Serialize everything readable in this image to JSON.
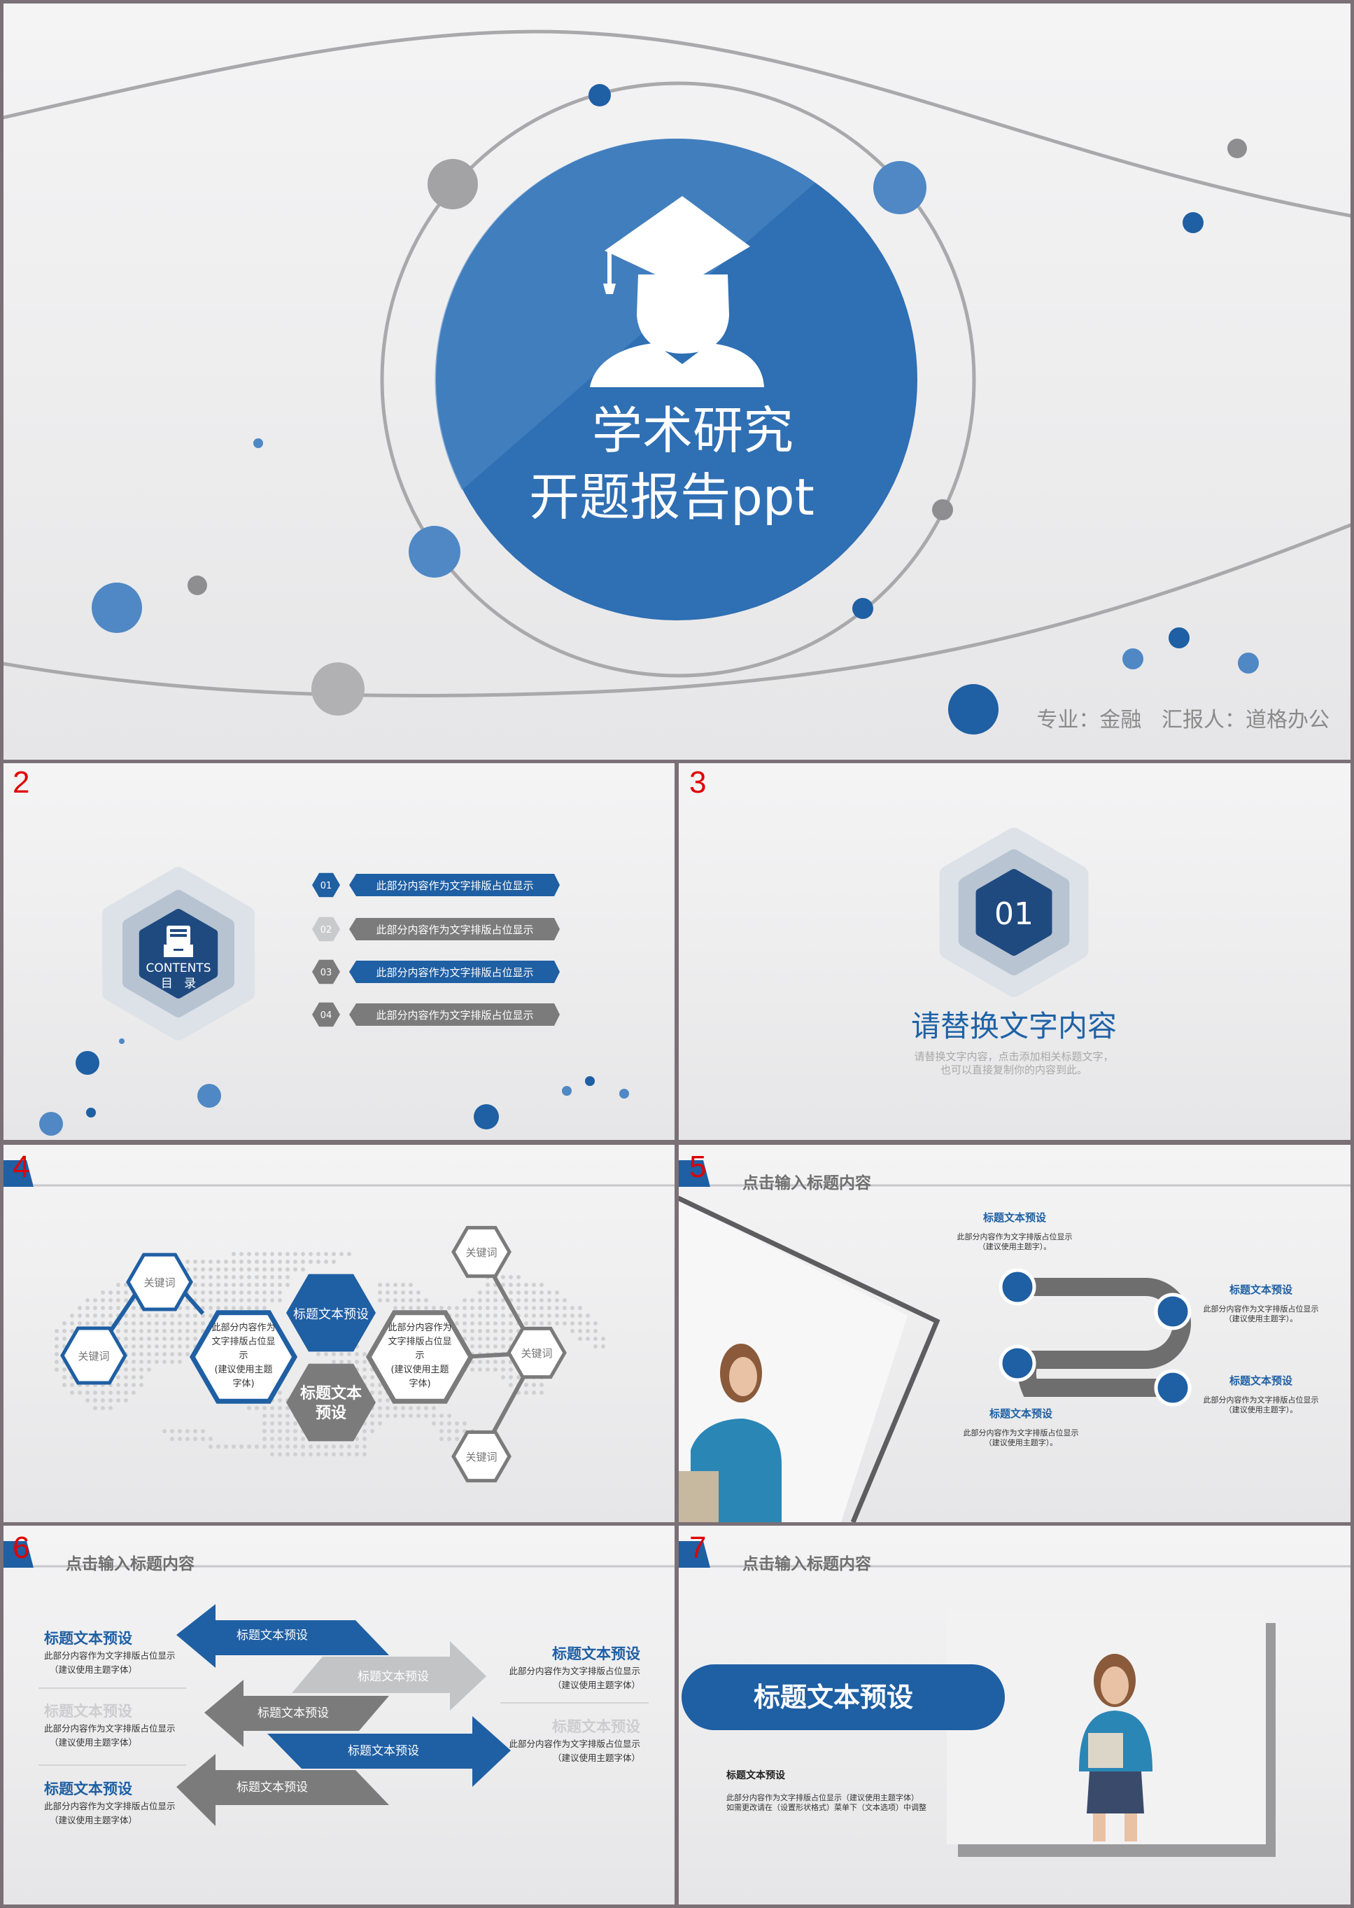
{
  "colors": {
    "blue": "#1f5fa3",
    "dark_blue": "#1f4a80",
    "gray": "#7b7b7b",
    "light_gray": "#c3c4c6",
    "slide_number": "#e00000"
  },
  "slide1": {
    "title_line1": "学术研究",
    "title_line2": "开题报告ppt",
    "footer": "专业：金融   汇报人：道格办公",
    "icon": "graduate-cap-icon"
  },
  "slide2": {
    "number": "2",
    "contents_en": "CONTENTS",
    "contents_cn": "目   录",
    "icon": "file-drawer-icon",
    "items": [
      {
        "num": "01",
        "label": "此部分内容作为文字排版占位显示"
      },
      {
        "num": "02",
        "label": "此部分内容作为文字排版占位显示"
      },
      {
        "num": "03",
        "label": "此部分内容作为文字排版占位显示"
      },
      {
        "num": "04",
        "label": "此部分内容作为文字排版占位显示"
      }
    ]
  },
  "slide3": {
    "number": "3",
    "badge": "01",
    "title": "请替换文字内容",
    "desc_line1": "请替换文字内容，点击添加相关标题文字，",
    "desc_line2": "也可以直接复制你的内容到此。"
  },
  "slide4": {
    "number": "4",
    "keywords": [
      "关键词",
      "关键词",
      "关键词",
      "关键词",
      "关键词"
    ],
    "title_blue": "标题文本预设",
    "title_gray_line1": "标题文本",
    "title_gray_line2": "预设",
    "body_lines": [
      "此部分内容作为",
      "文字排版占位显",
      "示",
      "(建议使用主题",
      "字体)"
    ]
  },
  "slide5": {
    "number": "5",
    "header": "点击输入标题内容",
    "points": [
      {
        "title": "标题文本预设",
        "line1": "此部分内容作为文字排版占位显示",
        "line2": "（建议使用主题字）。"
      },
      {
        "title": "标题文本预设",
        "line1": "此部分内容作为文字排版占位显示",
        "line2": "（建议使用主题字）。"
      },
      {
        "title": "标题文本预设",
        "line1": "此部分内容作为文字排版占位显示",
        "line2": "（建议使用主题字）。"
      },
      {
        "title": "标题文本预设",
        "line1": "此部分内容作为文字排版占位显示",
        "line2": "（建议使用主题字）。"
      }
    ]
  },
  "slide6": {
    "number": "6",
    "header": "点击输入标题内容",
    "arrows": [
      "标题文本预设",
      "标题文本预设",
      "标题文本预设",
      "标题文本预设",
      "标题文本预设"
    ],
    "left_blocks": [
      {
        "title": "标题文本预设",
        "line1": "此部分内容作为文字排版占位显示",
        "line2": "（建议使用主题字体）"
      },
      {
        "title": "标题文本预设",
        "line1": "此部分内容作为文字排版占位显示",
        "line2": "（建议使用主题字体）"
      },
      {
        "title": "标题文本预设",
        "line1": "此部分内容作为文字排版占位显示",
        "line2": "（建议使用主题字体）"
      }
    ],
    "right_blocks": [
      {
        "title": "标题文本预设",
        "line1": "此部分内容作为文字排版占位显示",
        "line2": "（建议使用主题字体）"
      },
      {
        "title": "标题文本预设",
        "line1": "此部分内容作为文字排版占位显示",
        "line2": "（建议使用主题字体）"
      }
    ]
  },
  "slide7": {
    "number": "7",
    "header": "点击输入标题内容",
    "pill_title": "标题文本预设",
    "sub_title": "标题文本预设",
    "line1": "此部分内容作为文字排版占位显示（建议使用主题字体）",
    "line2": "如需更改请在（设置形状格式）菜单下（文本选项）中调整"
  }
}
